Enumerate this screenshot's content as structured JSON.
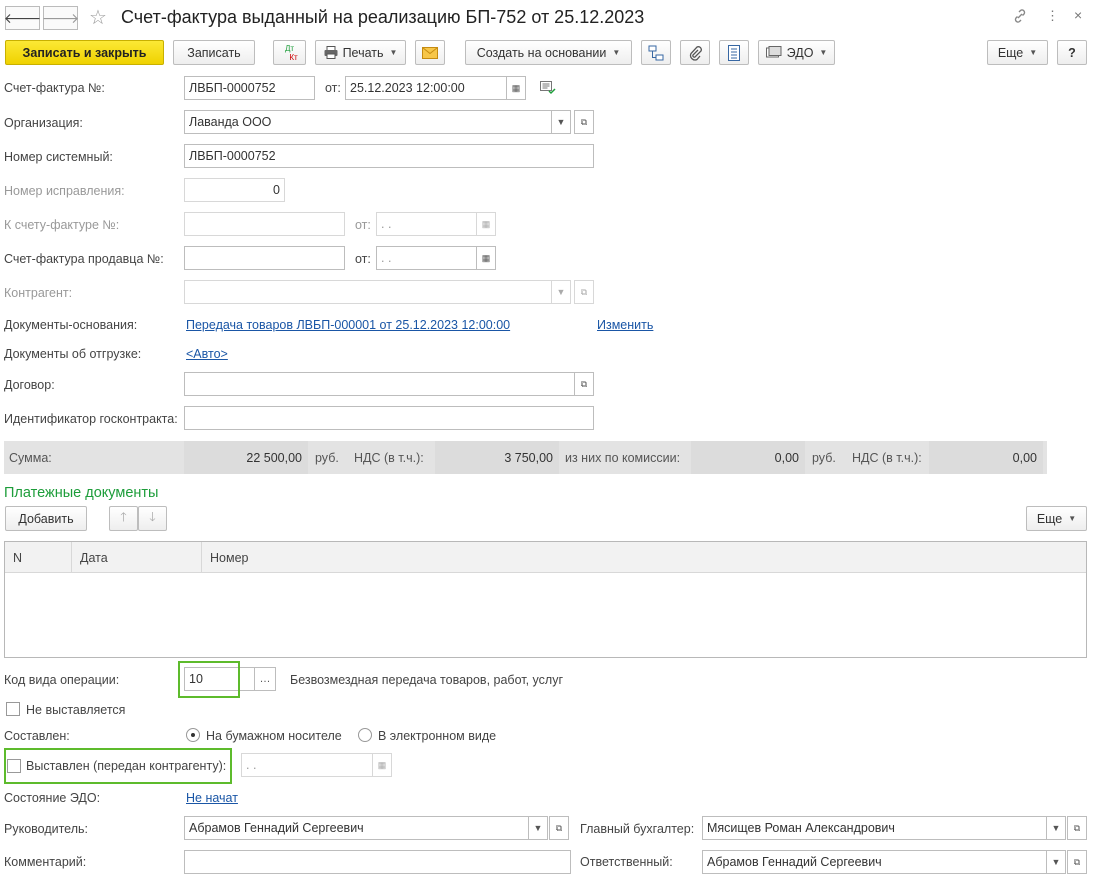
{
  "window": {
    "title": "Счет-фактура выданный на реализацию БП-752 от 25.12.2023"
  },
  "toolbar": {
    "save_close": "Записать и закрыть",
    "save": "Записать",
    "dtkt_top": "Дт",
    "dtkt_bottom": "Кт",
    "print": "Печать",
    "create_based": "Создать на основании",
    "edo": "ЭДО",
    "more": "Еще",
    "help": "?"
  },
  "form": {
    "invoice_label": "Счет-фактура №:",
    "invoice_number": "ЛВБП-0000752",
    "from_label": "от:",
    "invoice_date": "25.12.2023 12:00:00",
    "org_label": "Организация:",
    "org_value": "Лаванда ООО",
    "sysnum_label": "Номер системный:",
    "sysnum_value": "ЛВБП-0000752",
    "correction_label": "Номер исправления:",
    "correction_value": "0",
    "to_invoice_label": "К счету-фактуре №:",
    "to_invoice_value": "",
    "to_invoice_from_label": "от:",
    "empty_date": " .  .",
    "seller_invoice_label": "Счет-фактура продавца №:",
    "seller_invoice_value": "",
    "seller_from_label": "от:",
    "counterparty_label": "Контрагент:",
    "counterparty_value": "",
    "base_docs_label": "Документы-основания:",
    "base_docs_link": "Передача товаров ЛВБП-000001 от 25.12.2023 12:00:00",
    "change_link": "Изменить",
    "shipment_label": "Документы об отгрузке:",
    "shipment_link": "<Авто>",
    "contract_label": "Договор:",
    "contract_value": "",
    "gov_id_label": "Идентификатор госконтракта:",
    "gov_id_value": ""
  },
  "sums": {
    "sum_label": "Сумма:",
    "sum_value": "22 500,00",
    "cur1": "руб.",
    "vat_label": "НДС (в т.ч.):",
    "vat_value": "3 750,00",
    "commission_label": "из них по комиссии:",
    "commission_value": "0,00",
    "cur2": "руб.",
    "vat2_label": "НДС (в т.ч.):",
    "vat2_value": "0,00"
  },
  "payments": {
    "title": "Платежные документы",
    "add": "Добавить",
    "more": "Еще",
    "columns": [
      "N",
      "Дата",
      "Номер"
    ]
  },
  "bottom": {
    "opcode_label": "Код вида операции:",
    "opcode_value": "10",
    "opcode_desc": "Безвозмездная передача товаров, работ, услуг",
    "not_issued_label": "Не выставляется",
    "composed_label": "Составлен:",
    "paper_label": "На бумажном носителе",
    "electronic_label": "В электронном виде",
    "issued_label": "Выставлен (передан контрагенту):",
    "issued_date": " .  .",
    "edo_state_label": "Состояние ЭДО:",
    "edo_state_link": "Не начат",
    "manager_label": "Руководитель:",
    "manager_value": "Абрамов Геннадий Сергеевич",
    "chief_acc_label": "Главный бухгалтер:",
    "chief_acc_value": "Мясищев Роман Александрович",
    "comment_label": "Комментарий:",
    "comment_value": "",
    "responsible_label": "Ответственный:",
    "responsible_value": "Абрамов Геннадий Сергеевич"
  },
  "colors": {
    "accent": "#1d9d3a",
    "primary_button": "#f5dc18",
    "highlight": "#5dbb2c",
    "link": "#1a56a6"
  },
  "icons": [
    "back-arrow-icon",
    "forward-arrow-icon",
    "star-icon",
    "link-icon",
    "kebab-icon",
    "close-icon",
    "printer-icon",
    "envelope-icon",
    "structure-icon",
    "paperclip-icon",
    "report-icon",
    "edo-icon",
    "calendar-icon",
    "open-icon",
    "up-arrow-icon",
    "down-arrow-icon"
  ]
}
